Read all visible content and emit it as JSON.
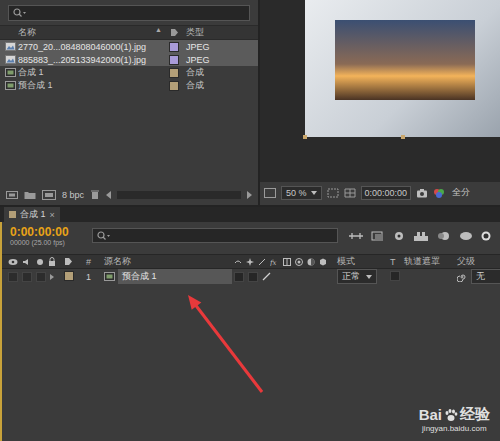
{
  "project_panel": {
    "columns": {
      "name": "名称",
      "sort": "▲",
      "type": "类型"
    },
    "items": [
      {
        "name": "2770_20...084808046000(1).jpg",
        "type": "JPEG",
        "kind": "footage",
        "color": "#a99bd8",
        "selected": true
      },
      {
        "name": "885883_...205133942000(1).jpg",
        "type": "JPEG",
        "kind": "footage",
        "color": "#a99bd8",
        "selected": true
      },
      {
        "name": "合成 1",
        "type": "合成",
        "kind": "composition",
        "color": "#b39f78",
        "selected": false
      },
      {
        "name": "预合成 1",
        "type": "合成",
        "kind": "composition",
        "color": "#b39f78",
        "selected": false
      }
    ],
    "footer": {
      "bit_depth": "8 bpc"
    }
  },
  "viewer": {
    "zoom": "50 %",
    "timecode": "0:00:00:00",
    "resolution": "全分"
  },
  "timeline": {
    "tab": {
      "label": "合成 1",
      "close": "×"
    },
    "timecode": "0:00:00:00",
    "frame_info": "00000 (25.00 fps)",
    "columns": {
      "number": "#",
      "source_name": "源名称",
      "mode": "模式",
      "t": "T",
      "track_matte": "轨道遮罩",
      "parent": "父级"
    },
    "layers": [
      {
        "number": "1",
        "name": "预合成 1",
        "mode": "正常",
        "parent": "无",
        "selected": false
      }
    ]
  },
  "watermark": {
    "brand_left": "Bai",
    "brand_right": "经验",
    "url": "jingyan.baidu.com"
  }
}
